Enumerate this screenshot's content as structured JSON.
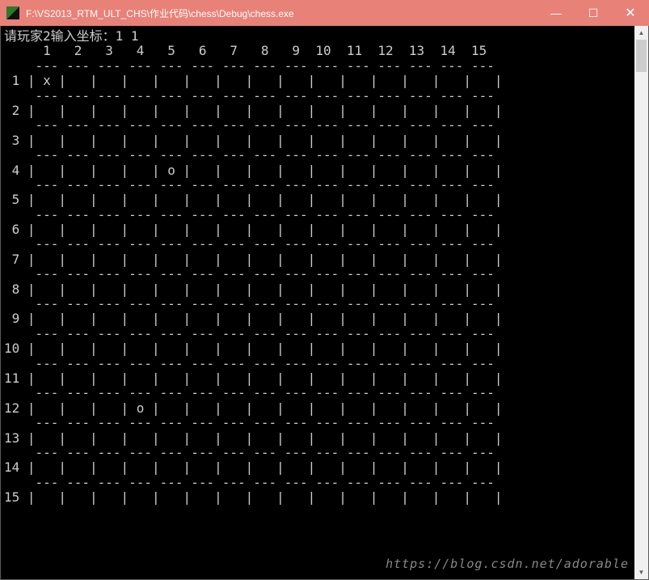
{
  "window": {
    "title": "F:\\VS2013_RTM_ULT_CHS\\作业代码\\chess\\Debug\\chess.exe",
    "minimize": "—",
    "maximize": "☐",
    "close": "✕"
  },
  "console": {
    "prompt": "请玩家2输入坐标：",
    "input": "1 1",
    "board_size": 15,
    "pieces": [
      {
        "row": 1,
        "col": 1,
        "mark": "x"
      },
      {
        "row": 4,
        "col": 5,
        "mark": "o"
      },
      {
        "row": 12,
        "col": 4,
        "mark": "o"
      }
    ]
  },
  "watermark": "https://blog.csdn.net/adorable"
}
